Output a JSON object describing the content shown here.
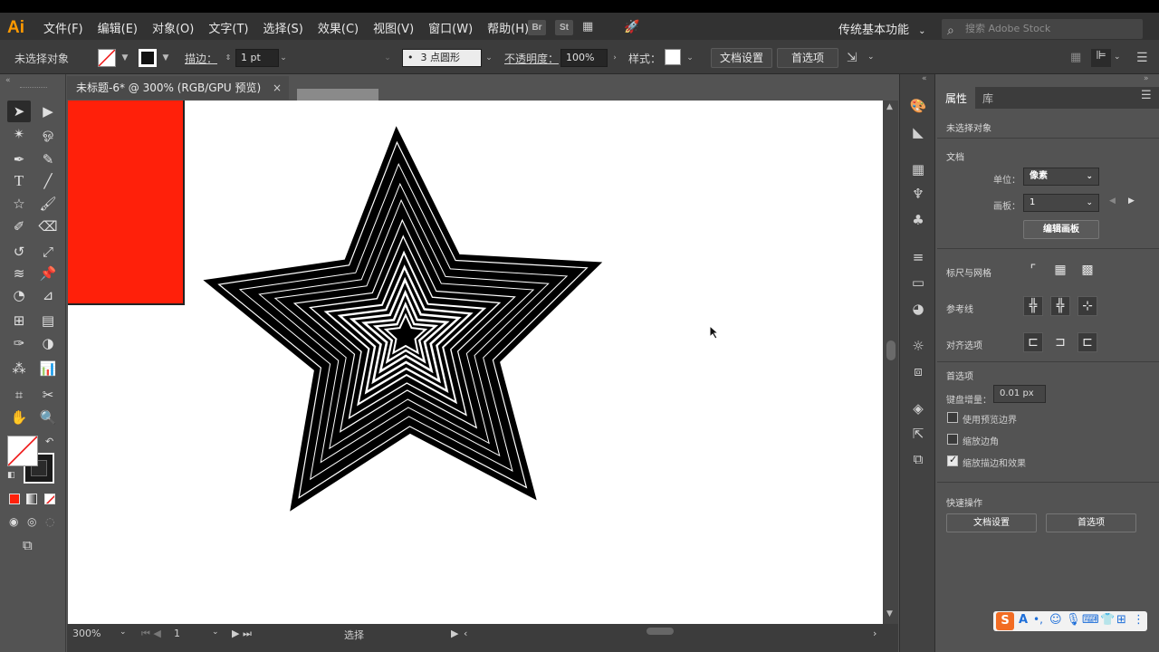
{
  "app": {
    "logo": "Ai"
  },
  "menu": [
    "文件(F)",
    "编辑(E)",
    "对象(O)",
    "文字(T)",
    "选择(S)",
    "效果(C)",
    "视图(V)",
    "窗口(W)",
    "帮助(H)"
  ],
  "app_icons": [
    "Br",
    "St"
  ],
  "workspace": "传统基本功能",
  "search_placeholder": "搜索 Adobe Stock",
  "control": {
    "selection_label": "未选择对象",
    "stroke_label": "描边：",
    "stroke_value": "1 pt",
    "brush_value": "3 点圆形",
    "brush_bullet": "•",
    "opacity_label": "不透明度：",
    "opacity_value": "100%",
    "style_label": "样式：",
    "doc_setup": "文档设置",
    "prefs": "首选项"
  },
  "document": {
    "tab_title": "未标题-6* @ 300% (RGB/GPU 预览)",
    "close": "×"
  },
  "status": {
    "zoom": "300%",
    "artboard": "1",
    "tool": "选择"
  },
  "colors": {
    "red_rect": "#ff200a",
    "accent": "#ff9a00"
  },
  "props": {
    "tab_properties": "属性",
    "tab_library": "库",
    "no_selection": "未选择对象",
    "doc_section": "文档",
    "unit_label": "单位：",
    "unit_value": "像素",
    "artboard_label": "画板：",
    "artboard_value": "1",
    "edit_artboards": "编辑画板",
    "rulers_grids": "标尺与网格",
    "guides": "参考线",
    "snap_options": "对齐选项",
    "prefs_section": "首选项",
    "keyboard_increment_label": "键盘增量：",
    "keyboard_increment_value": "0.01 px",
    "use_preview_bounds": "使用预览边界",
    "scale_corners": "缩放边角",
    "scale_strokes_effects": "缩放描边和效果",
    "quick_actions": "快速操作",
    "quick_doc_setup": "文档设置",
    "quick_prefs": "首选项"
  }
}
